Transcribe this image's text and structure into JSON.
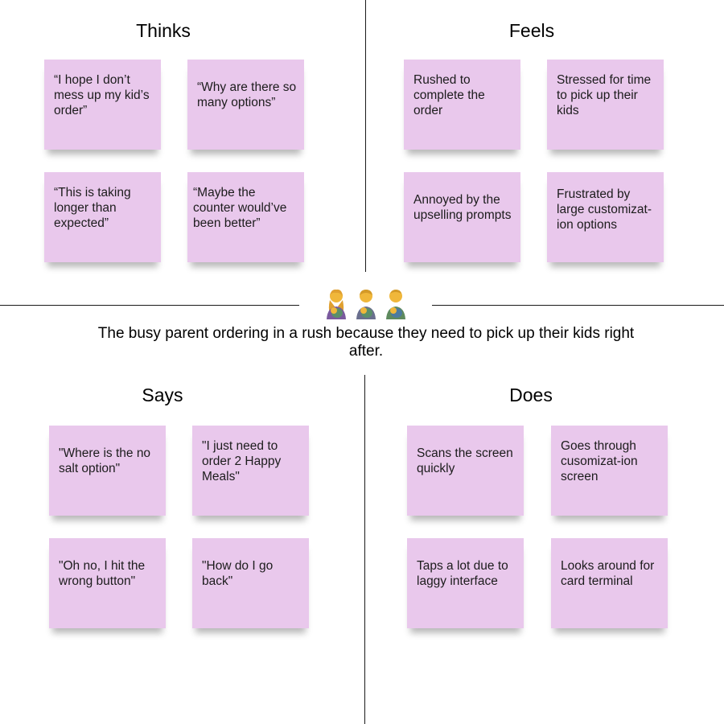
{
  "persona": {
    "description": "The busy parent ordering in a rush because they need to pick up their kids right after."
  },
  "quadrants": {
    "thinks": {
      "title": "Thinks",
      "notes": [
        "“I hope I don’t mess up my kid’s order”",
        "“Why are there so many options”",
        "“This is taking longer than expected”",
        "“Maybe the counter would’ve been better”"
      ]
    },
    "feels": {
      "title": "Feels",
      "notes": [
        "Rushed to complete the order",
        "Stressed for time to pick up their kids",
        "Annoyed by the upselling prompts",
        "Frustrated by large customizat-ion options"
      ]
    },
    "says": {
      "title": "Says",
      "notes": [
        "\"Where is the no salt option\"",
        "\"I just need to order 2 Happy Meals\"",
        "\"Oh no, I hit the wrong button\"",
        "\"How do I go back\""
      ]
    },
    "does": {
      "title": "Does",
      "notes": [
        "Scans the screen quickly",
        "Goes through cusomizat-ion screen",
        "Taps a lot due to laggy interface",
        "Looks around for card terminal"
      ]
    }
  },
  "colors": {
    "sticky_note": "#e9c8ec",
    "divider": "#1a1a1a"
  },
  "icons": [
    "parent-holding-baby-icon",
    "parent-holding-baby-icon",
    "parent-holding-baby-icon"
  ]
}
